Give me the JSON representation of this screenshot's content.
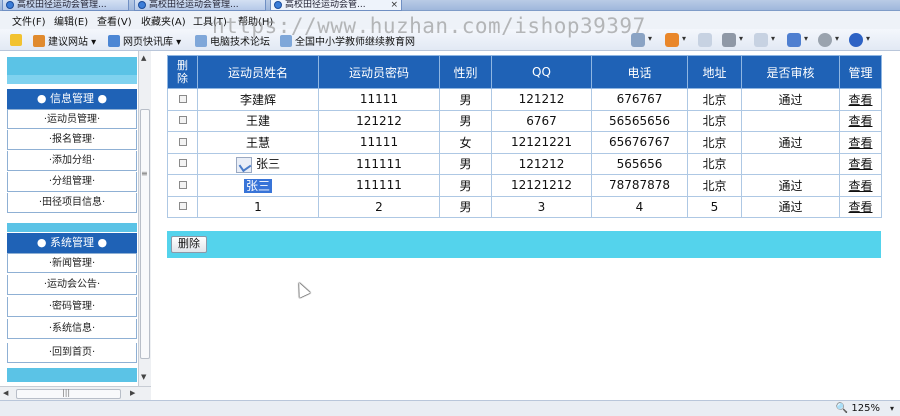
{
  "browser": {
    "tabs": [
      {
        "label": "高校田径运动会管理..."
      },
      {
        "label": "高校田径运动会管理..."
      },
      {
        "label": "高校田径运动会管..."
      }
    ],
    "tab_close_icon": "×",
    "menu": [
      "文件(F)",
      "编辑(E)",
      "查看(V)",
      "收藏夹(A)",
      "工具(T)",
      "帮助(H)"
    ],
    "favorites": [
      {
        "label": "建议网站 ▾",
        "icon": "star-folder-icon"
      },
      {
        "label": "网页快讯库 ▾",
        "icon": "web-slice-icon"
      },
      {
        "label": "电脑技术论坛",
        "icon": "page-icon"
      },
      {
        "label": "全国中小学教师继续教育网",
        "icon": "page-icon"
      }
    ],
    "watermark": "https://www.huzhan.com/ishop39397",
    "zoom": "125%"
  },
  "sidebar": {
    "groups": [
      {
        "title": "● 信息管理 ●",
        "items": [
          "·运动员管理·",
          "·报名管理·",
          "·添加分组·",
          "·分组管理·",
          "·田径项目信息·"
        ]
      },
      {
        "title": "● 系统管理 ●",
        "items": [
          "·新闻管理·",
          "·运动会公告·",
          "·密码管理·",
          "·系统信息·",
          "·回到首页·"
        ]
      }
    ]
  },
  "table": {
    "headers": [
      "删除",
      "运动员姓名",
      "运动员密码",
      "性别",
      "QQ",
      "电话",
      "地址",
      "是否审核",
      "管理"
    ],
    "rows": [
      {
        "name": "李建辉",
        "password": "11111",
        "gender": "男",
        "qq": "121212",
        "phone": "676767",
        "address": "北京",
        "approved": "通过",
        "action": "查看"
      },
      {
        "name": "王建",
        "password": "121212",
        "gender": "男",
        "qq": "6767",
        "phone": "56565656",
        "address": "北京",
        "approved": "",
        "action": "查看"
      },
      {
        "name": "王慧",
        "password": "11111",
        "gender": "女",
        "qq": "12121221",
        "phone": "65676767",
        "address": "北京",
        "approved": "通过",
        "action": "查看"
      },
      {
        "name": "张三",
        "password": "111111",
        "gender": "男",
        "qq": "121212",
        "phone": "565656",
        "address": "北京",
        "approved": "",
        "action": "查看"
      },
      {
        "name": "张三",
        "password": "111111",
        "gender": "男",
        "qq": "12121212",
        "phone": "78787878",
        "address": "北京",
        "approved": "通过",
        "action": "查看"
      },
      {
        "name": "1",
        "password": "2",
        "gender": "男",
        "qq": "3",
        "phone": "4",
        "address": "5",
        "approved": "通过",
        "action": "查看"
      }
    ]
  },
  "actions": {
    "delete_label": "删除"
  },
  "colors": {
    "header_bg": "#1f62b6",
    "accent_cyan": "#54d3ec",
    "border": "#aec8e4"
  }
}
